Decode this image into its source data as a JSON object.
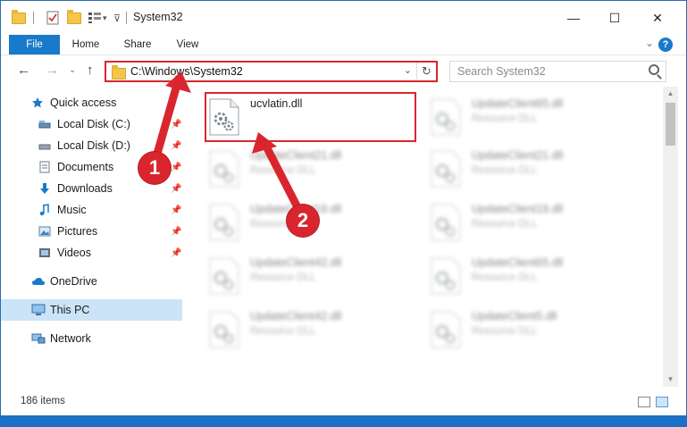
{
  "window": {
    "title": "System32",
    "minimize": "—",
    "maximize": "☐",
    "close": "✕"
  },
  "ribbon": {
    "tabs": [
      "File",
      "Home",
      "Share",
      "View"
    ],
    "collapse": "⌄",
    "help": "?"
  },
  "nav": {
    "back": "←",
    "forward": "→",
    "recent": "⌄",
    "up": "↑",
    "address": "C:\\Windows\\System32",
    "address_dropdown": "⌄",
    "refresh": "↻",
    "search_placeholder": "Search System32"
  },
  "sidebar": {
    "items": [
      {
        "label": "Quick access",
        "icon": "star-icon"
      },
      {
        "label": "Local Disk (C:)",
        "icon": "drive-icon"
      },
      {
        "label": "Local Disk (D:)",
        "icon": "drive-icon"
      },
      {
        "label": "Documents",
        "icon": "documents-icon"
      },
      {
        "label": "Downloads",
        "icon": "download-icon"
      },
      {
        "label": "Music",
        "icon": "music-icon"
      },
      {
        "label": "Pictures",
        "icon": "pictures-icon"
      },
      {
        "label": "Videos",
        "icon": "videos-icon"
      },
      {
        "label": "OneDrive",
        "icon": "cloud-icon"
      },
      {
        "label": "This PC",
        "icon": "computer-icon"
      },
      {
        "label": "Network",
        "icon": "network-icon"
      }
    ]
  },
  "files": [
    {
      "name": "ucvlatin.dll",
      "type": ""
    },
    {
      "name": "UpdateClient65.dll",
      "type": "Resource DLL"
    },
    {
      "name": "UpdateClient21.dll",
      "type": "Resource DLL"
    },
    {
      "name": "UpdateClient21.dll",
      "type": "Resource DLL"
    },
    {
      "name": "UpdateClient19.dll",
      "type": "Resource DLL"
    },
    {
      "name": "UpdateClient19.dll",
      "type": "Resource DLL"
    },
    {
      "name": "UpdateClient42.dll",
      "type": "Resource DLL"
    },
    {
      "name": "UpdateClient65.dll",
      "type": "Resource DLL"
    },
    {
      "name": "UpdateClient42.dll",
      "type": "Resource DLL"
    },
    {
      "name": "UpdateClient5.dll",
      "type": "Resource DLL"
    }
  ],
  "annotations": {
    "step1": "1",
    "step2": "2",
    "color": "#d9262e"
  },
  "status": {
    "item_count": "186 items"
  }
}
